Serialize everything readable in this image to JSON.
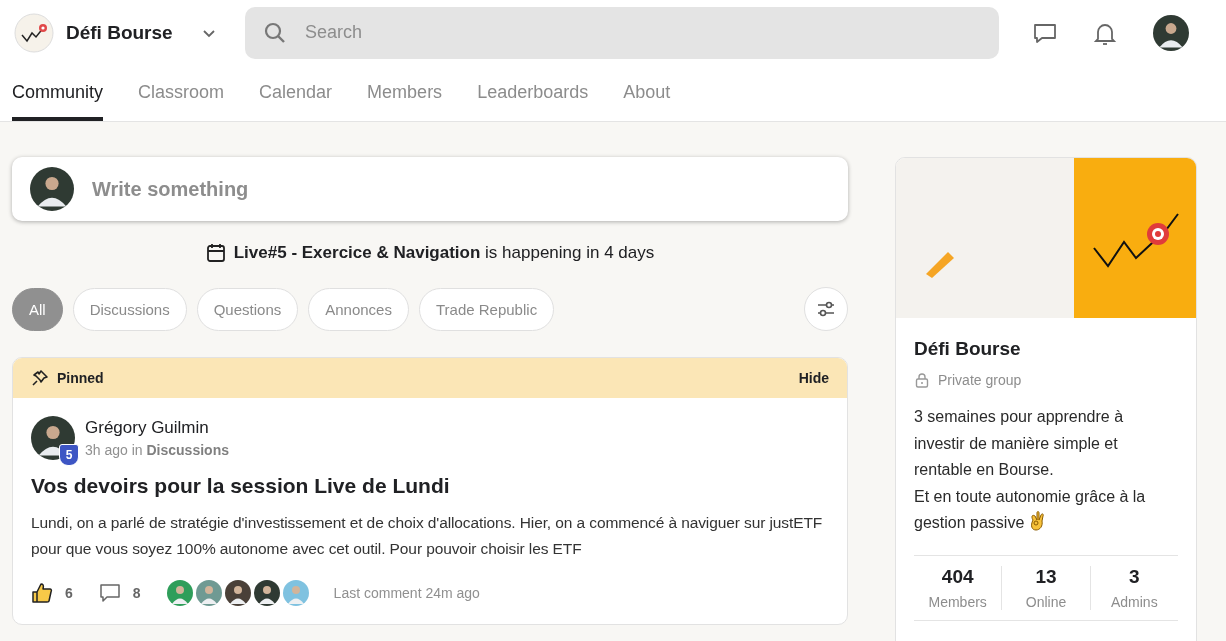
{
  "header": {
    "group_name": "Défi Bourse",
    "search": {
      "placeholder": "Search"
    }
  },
  "tabs": [
    {
      "label": "Community",
      "selected": true
    },
    {
      "label": "Classroom",
      "selected": false
    },
    {
      "label": "Calendar",
      "selected": false
    },
    {
      "label": "Members",
      "selected": false
    },
    {
      "label": "Leaderboards",
      "selected": false
    },
    {
      "label": "About",
      "selected": false
    }
  ],
  "composer": {
    "placeholder": "Write something"
  },
  "event_notice": "**Live#5 - Exercice & Navigation** is happening in 4 days",
  "filters": [
    {
      "label": "All",
      "selected": true
    },
    {
      "label": "Discussions",
      "selected": false
    },
    {
      "label": "Questions",
      "selected": false
    },
    {
      "label": "Annonces",
      "selected": false
    },
    {
      "label": "Trade Republic",
      "selected": false
    }
  ],
  "pinned_post": {
    "banner_label": "Pinned",
    "hide_label": "Hide",
    "author": "Grégory Guilmin",
    "level_badge": "5",
    "meta": "3h ago in **Discussions**",
    "title": "Vos devoirs pour la session Live de Lundi",
    "body": "Lundi, on a parlé de stratégie d'investissement et de choix d'allocations. Hier, on a commencé à naviguer sur justETF pour que vous soyez 100% autonome avec cet outil. Pour pouvoir choisir les ETF",
    "likes": "6",
    "comments": "8",
    "last_comment": "Last comment 24m ago"
  },
  "group_card": {
    "name": "Défi Bourse",
    "privacy": "Private group",
    "description": "3 semaines pour apprendre à investir de manière simple et rentable en Bourse.\nEt en toute autonomie grâce à la gestion passive",
    "stats": [
      {
        "value": "404",
        "label": "Members"
      },
      {
        "value": "13",
        "label": "Online"
      },
      {
        "value": "3",
        "label": "Admins"
      }
    ]
  }
}
